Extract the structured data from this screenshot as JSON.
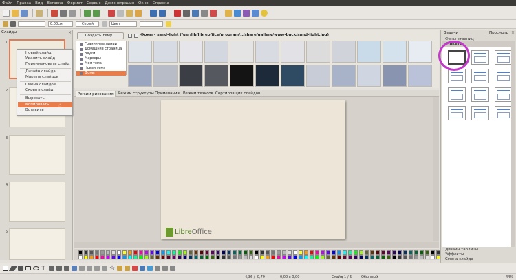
{
  "menu": [
    "Файл",
    "Правка",
    "Вид",
    "Вставка",
    "Формат",
    "Сервис",
    "Демонстрация",
    "Окно",
    "Справка"
  ],
  "toolbar2": {
    "line_width": "0,00см",
    "line_color": "Серый",
    "area_label": "Цвет"
  },
  "slides_panel": {
    "title": "Слайды",
    "numbers": [
      "1",
      "2",
      "3",
      "4",
      "5"
    ]
  },
  "slide_logo": {
    "libre": "Libre",
    "office": "Office"
  },
  "context_menu": {
    "items": [
      "Новый слайд",
      "Удалить слайд",
      "Переименовать слайд",
      "Дизайн слайда",
      "Макеты слайдов",
      "Смена слайдов",
      "Скрыть слайд",
      "Вырезать",
      "Копировать",
      "Вставить"
    ],
    "highlighted": "Копировать"
  },
  "gallery": {
    "create_theme": "Создать тему...",
    "path": "Фоны - sand-light (/usr/lib/libreoffice/program/../share/gallery/www-back/sand-light.jpg)",
    "themes": [
      "Граничные линии",
      "Домашняя страница",
      "Звуки",
      "Маркеры",
      "Моя тема",
      "Новая тема",
      "Фоны"
    ],
    "selected_theme": "Фоны"
  },
  "tabs": [
    "Режим рисования",
    "Режим структуры",
    "Примечания",
    "Режим тезисов",
    "Сортировщик слайдов"
  ],
  "tasks": {
    "title": "Задачи",
    "view": "Просмотр",
    "master": "Фоны страниц",
    "layouts": "Макеты",
    "table_design": "Дизайн таблицы",
    "effects": "Эффекты",
    "transition": "Смена слайда"
  },
  "status": {
    "coords": "4,36 / -0,79",
    "size": "0,00 x 0,00",
    "slide": "Слайд 1 / 5",
    "master": "Обычный",
    "zoom": "44%"
  },
  "colors": {
    "accent": "#e87c4a",
    "highlight_circle": "#c23bc8",
    "menubar": "#3c3b37"
  }
}
